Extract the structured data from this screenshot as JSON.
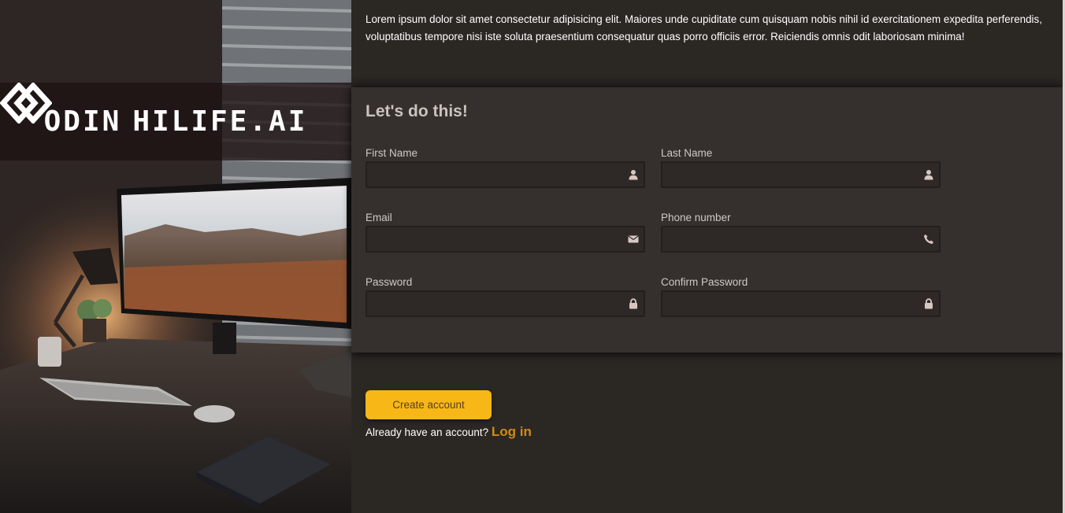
{
  "brand": {
    "left_word": "ODIN",
    "right_word": "HILIFE.AI",
    "logo_icon": "interlocked-diamonds-icon"
  },
  "intro_text": "Lorem ipsum dolor sit amet consectetur adipisicing elit. Maiores unde cupiditate cum quisquam nobis nihil id exercitationem expedita perferendis, voluptatibus tempore nisi iste soluta praesentium consequatur quas porro officiis error. Reiciendis omnis odit laboriosam minima!",
  "form": {
    "title": "Let's do this!",
    "fields": [
      {
        "label": "First Name",
        "value": "",
        "icon": "user-icon"
      },
      {
        "label": "Last Name",
        "value": "",
        "icon": "user-icon"
      },
      {
        "label": "Email",
        "value": "",
        "icon": "envelope-icon"
      },
      {
        "label": "Phone number",
        "value": "",
        "icon": "phone-icon"
      },
      {
        "label": "Password",
        "value": "",
        "icon": "lock-icon"
      },
      {
        "label": "Confirm Password",
        "value": "",
        "icon": "lock-icon"
      }
    ]
  },
  "actions": {
    "create_label": "Create account",
    "login_prompt": "Already have an account?",
    "login_link": "Log in"
  },
  "colors": {
    "background": "#2b2824",
    "card": "#35302e",
    "accent": "#f7b716",
    "link": "#d18a16"
  }
}
